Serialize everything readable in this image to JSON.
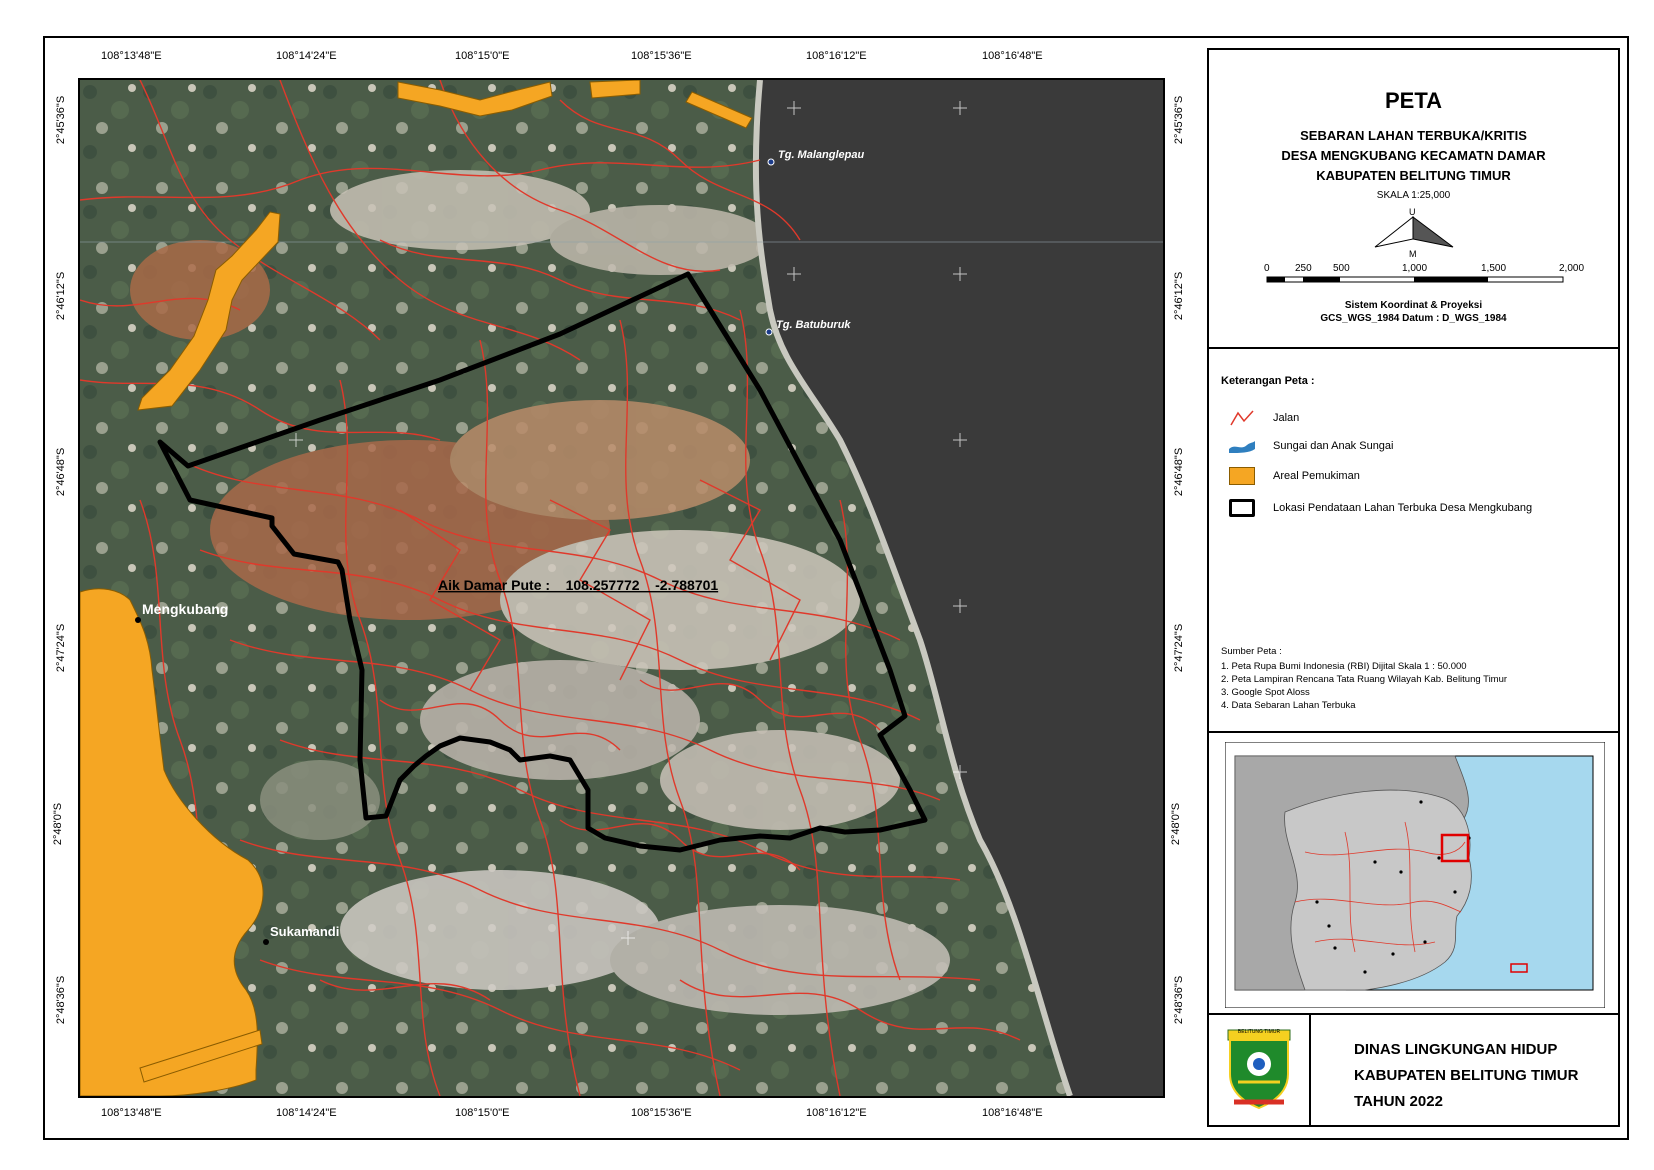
{
  "lon_labels": [
    "108°13'48\"E",
    "108°14'24\"E",
    "108°15'0\"E",
    "108°15'36\"E",
    "108°16'12\"E",
    "108°16'48\"E"
  ],
  "lat_labels": [
    "2°45'36\"S",
    "2°46'12\"S",
    "2°46'48\"S",
    "2°47'24\"S",
    "2°48'0\"S",
    "2°48'36\"S"
  ],
  "map_labels": {
    "tg_malanglepau": "Tg. Malanglepau",
    "tg_batuburuk": "Tg. Batuburuk",
    "mengkubang": "Mengkubang",
    "sukamandi": "Sukamandi",
    "aik_damar": "Aik Damar Pute :    108.257772    -2.788701"
  },
  "title": {
    "peta": "PETA",
    "line1": "SEBARAN LAHAN TERBUKA/KRITIS",
    "line2": "DESA MENGKUBANG KECAMATN DAMAR",
    "line3": "KABUPATEN BELITUNG TIMUR",
    "skala": "SKALA    1:25,000",
    "north_u": "U",
    "north_m": "M",
    "scale_ticks": [
      "0",
      "250",
      "500",
      "1,000",
      "1,500",
      "2,000"
    ],
    "crs_line1": "Sistem Koordinat & Proyeksi",
    "crs_line2": "GCS_WGS_1984 Datum : D_WGS_1984"
  },
  "legend": {
    "heading": "Keterangan Peta :",
    "items": [
      {
        "label": "Jalan",
        "color": "#e0392b"
      },
      {
        "label": "Sungai dan Anak Sungai",
        "color": "#2f7fbf"
      },
      {
        "label": "Areal Pemukiman",
        "color": "#f5a623"
      },
      {
        "label": "Lokasi Pendataan Lahan Terbuka Desa Mengkubang",
        "color": "#000000"
      }
    ]
  },
  "sources": {
    "heading": "Sumber Peta :",
    "items": [
      "1. Peta Rupa Bumi Indonesia (RBI) Dijital Skala 1 : 50.000",
      "2. Peta Lampiran Rencana Tata Ruang Wilayah Kab. Belitung Timur",
      "3. Google Spot Aloss",
      "4. Data Sebaran Lahan Terbuka"
    ]
  },
  "footer": {
    "line1": "DINAS LINGKUNGAN HIDUP",
    "line2": "KABUPATEN BELITUNG TIMUR",
    "line3": "TAHUN 2022",
    "logo_text": "BELITUNG TIMUR"
  },
  "colors": {
    "sea": "#3a3a3a",
    "land": "#4b5c48",
    "road": "#e0392b",
    "settlement": "#f5a623",
    "boundary": "#000000",
    "inset_sea": "#a6d8ee",
    "inset_land": "#c8c8c8"
  }
}
